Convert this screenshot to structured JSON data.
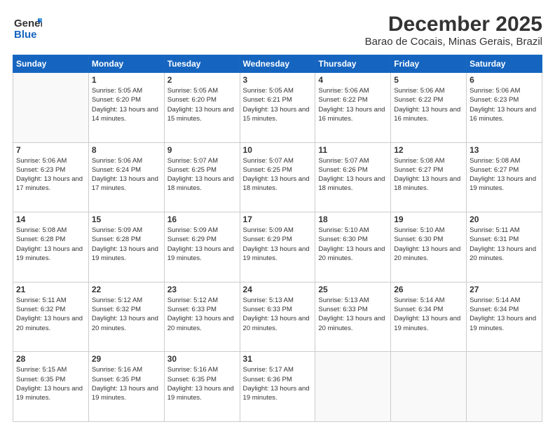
{
  "logo": {
    "line1": "General",
    "line2": "Blue"
  },
  "title": "December 2025",
  "subtitle": "Barao de Cocais, Minas Gerais, Brazil",
  "weekdays": [
    "Sunday",
    "Monday",
    "Tuesday",
    "Wednesday",
    "Thursday",
    "Friday",
    "Saturday"
  ],
  "weeks": [
    [
      {
        "day": "",
        "sunrise": "",
        "sunset": "",
        "daylight": ""
      },
      {
        "day": "1",
        "sunrise": "Sunrise: 5:05 AM",
        "sunset": "Sunset: 6:20 PM",
        "daylight": "Daylight: 13 hours and 14 minutes."
      },
      {
        "day": "2",
        "sunrise": "Sunrise: 5:05 AM",
        "sunset": "Sunset: 6:20 PM",
        "daylight": "Daylight: 13 hours and 15 minutes."
      },
      {
        "day": "3",
        "sunrise": "Sunrise: 5:05 AM",
        "sunset": "Sunset: 6:21 PM",
        "daylight": "Daylight: 13 hours and 15 minutes."
      },
      {
        "day": "4",
        "sunrise": "Sunrise: 5:06 AM",
        "sunset": "Sunset: 6:22 PM",
        "daylight": "Daylight: 13 hours and 16 minutes."
      },
      {
        "day": "5",
        "sunrise": "Sunrise: 5:06 AM",
        "sunset": "Sunset: 6:22 PM",
        "daylight": "Daylight: 13 hours and 16 minutes."
      },
      {
        "day": "6",
        "sunrise": "Sunrise: 5:06 AM",
        "sunset": "Sunset: 6:23 PM",
        "daylight": "Daylight: 13 hours and 16 minutes."
      }
    ],
    [
      {
        "day": "7",
        "sunrise": "Sunrise: 5:06 AM",
        "sunset": "Sunset: 6:23 PM",
        "daylight": "Daylight: 13 hours and 17 minutes."
      },
      {
        "day": "8",
        "sunrise": "Sunrise: 5:06 AM",
        "sunset": "Sunset: 6:24 PM",
        "daylight": "Daylight: 13 hours and 17 minutes."
      },
      {
        "day": "9",
        "sunrise": "Sunrise: 5:07 AM",
        "sunset": "Sunset: 6:25 PM",
        "daylight": "Daylight: 13 hours and 18 minutes."
      },
      {
        "day": "10",
        "sunrise": "Sunrise: 5:07 AM",
        "sunset": "Sunset: 6:25 PM",
        "daylight": "Daylight: 13 hours and 18 minutes."
      },
      {
        "day": "11",
        "sunrise": "Sunrise: 5:07 AM",
        "sunset": "Sunset: 6:26 PM",
        "daylight": "Daylight: 13 hours and 18 minutes."
      },
      {
        "day": "12",
        "sunrise": "Sunrise: 5:08 AM",
        "sunset": "Sunset: 6:27 PM",
        "daylight": "Daylight: 13 hours and 18 minutes."
      },
      {
        "day": "13",
        "sunrise": "Sunrise: 5:08 AM",
        "sunset": "Sunset: 6:27 PM",
        "daylight": "Daylight: 13 hours and 19 minutes."
      }
    ],
    [
      {
        "day": "14",
        "sunrise": "Sunrise: 5:08 AM",
        "sunset": "Sunset: 6:28 PM",
        "daylight": "Daylight: 13 hours and 19 minutes."
      },
      {
        "day": "15",
        "sunrise": "Sunrise: 5:09 AM",
        "sunset": "Sunset: 6:28 PM",
        "daylight": "Daylight: 13 hours and 19 minutes."
      },
      {
        "day": "16",
        "sunrise": "Sunrise: 5:09 AM",
        "sunset": "Sunset: 6:29 PM",
        "daylight": "Daylight: 13 hours and 19 minutes."
      },
      {
        "day": "17",
        "sunrise": "Sunrise: 5:09 AM",
        "sunset": "Sunset: 6:29 PM",
        "daylight": "Daylight: 13 hours and 19 minutes."
      },
      {
        "day": "18",
        "sunrise": "Sunrise: 5:10 AM",
        "sunset": "Sunset: 6:30 PM",
        "daylight": "Daylight: 13 hours and 20 minutes."
      },
      {
        "day": "19",
        "sunrise": "Sunrise: 5:10 AM",
        "sunset": "Sunset: 6:30 PM",
        "daylight": "Daylight: 13 hours and 20 minutes."
      },
      {
        "day": "20",
        "sunrise": "Sunrise: 5:11 AM",
        "sunset": "Sunset: 6:31 PM",
        "daylight": "Daylight: 13 hours and 20 minutes."
      }
    ],
    [
      {
        "day": "21",
        "sunrise": "Sunrise: 5:11 AM",
        "sunset": "Sunset: 6:32 PM",
        "daylight": "Daylight: 13 hours and 20 minutes."
      },
      {
        "day": "22",
        "sunrise": "Sunrise: 5:12 AM",
        "sunset": "Sunset: 6:32 PM",
        "daylight": "Daylight: 13 hours and 20 minutes."
      },
      {
        "day": "23",
        "sunrise": "Sunrise: 5:12 AM",
        "sunset": "Sunset: 6:33 PM",
        "daylight": "Daylight: 13 hours and 20 minutes."
      },
      {
        "day": "24",
        "sunrise": "Sunrise: 5:13 AM",
        "sunset": "Sunset: 6:33 PM",
        "daylight": "Daylight: 13 hours and 20 minutes."
      },
      {
        "day": "25",
        "sunrise": "Sunrise: 5:13 AM",
        "sunset": "Sunset: 6:33 PM",
        "daylight": "Daylight: 13 hours and 20 minutes."
      },
      {
        "day": "26",
        "sunrise": "Sunrise: 5:14 AM",
        "sunset": "Sunset: 6:34 PM",
        "daylight": "Daylight: 13 hours and 19 minutes."
      },
      {
        "day": "27",
        "sunrise": "Sunrise: 5:14 AM",
        "sunset": "Sunset: 6:34 PM",
        "daylight": "Daylight: 13 hours and 19 minutes."
      }
    ],
    [
      {
        "day": "28",
        "sunrise": "Sunrise: 5:15 AM",
        "sunset": "Sunset: 6:35 PM",
        "daylight": "Daylight: 13 hours and 19 minutes."
      },
      {
        "day": "29",
        "sunrise": "Sunrise: 5:16 AM",
        "sunset": "Sunset: 6:35 PM",
        "daylight": "Daylight: 13 hours and 19 minutes."
      },
      {
        "day": "30",
        "sunrise": "Sunrise: 5:16 AM",
        "sunset": "Sunset: 6:35 PM",
        "daylight": "Daylight: 13 hours and 19 minutes."
      },
      {
        "day": "31",
        "sunrise": "Sunrise: 5:17 AM",
        "sunset": "Sunset: 6:36 PM",
        "daylight": "Daylight: 13 hours and 19 minutes."
      },
      {
        "day": "",
        "sunrise": "",
        "sunset": "",
        "daylight": ""
      },
      {
        "day": "",
        "sunrise": "",
        "sunset": "",
        "daylight": ""
      },
      {
        "day": "",
        "sunrise": "",
        "sunset": "",
        "daylight": ""
      }
    ]
  ]
}
